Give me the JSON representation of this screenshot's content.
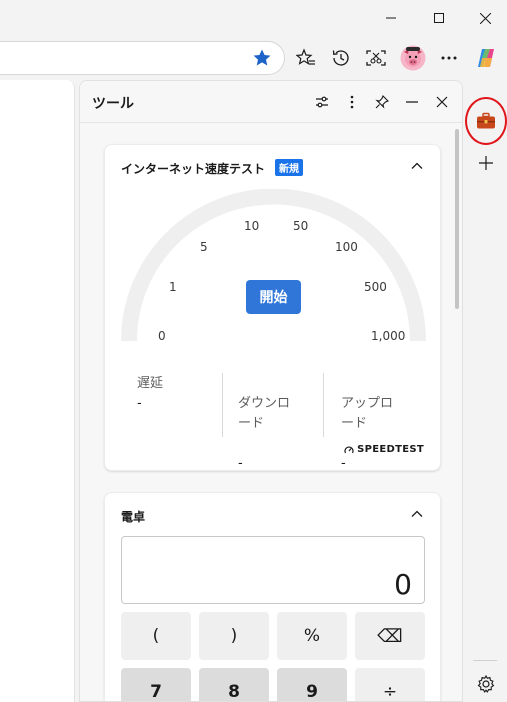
{
  "window": {
    "controls": [
      "minimize",
      "maximize",
      "close"
    ]
  },
  "toolbar": {
    "icons": [
      "favorites-star-icon",
      "collections-icon",
      "history-icon",
      "screenshot-icon",
      "profile-avatar",
      "more-icon",
      "copilot-icon"
    ]
  },
  "tools_pane": {
    "title": "ツール",
    "speedtest": {
      "title": "インターネット速度テスト",
      "badge": "新規",
      "ticks": [
        "0",
        "1",
        "5",
        "10",
        "50",
        "100",
        "500",
        "1,000"
      ],
      "start_label": "開始",
      "metrics": [
        {
          "label": "遅延",
          "value": "-"
        },
        {
          "label": "ダウンロ\nード",
          "value": "-"
        },
        {
          "label": "アップロ\nード",
          "value": "-"
        }
      ],
      "brand": "SPEEDTEST"
    },
    "calculator": {
      "title": "電卓",
      "display": "0",
      "keys_row1": [
        "(",
        ")",
        "%",
        "⌫"
      ],
      "keys_row2": [
        "7",
        "8",
        "9",
        "÷"
      ]
    }
  },
  "colors": {
    "accent": "#2f76d8",
    "badge": "#1a73e8",
    "highlight_circle": "#e0161b",
    "tools_icon": "#c8481c"
  }
}
